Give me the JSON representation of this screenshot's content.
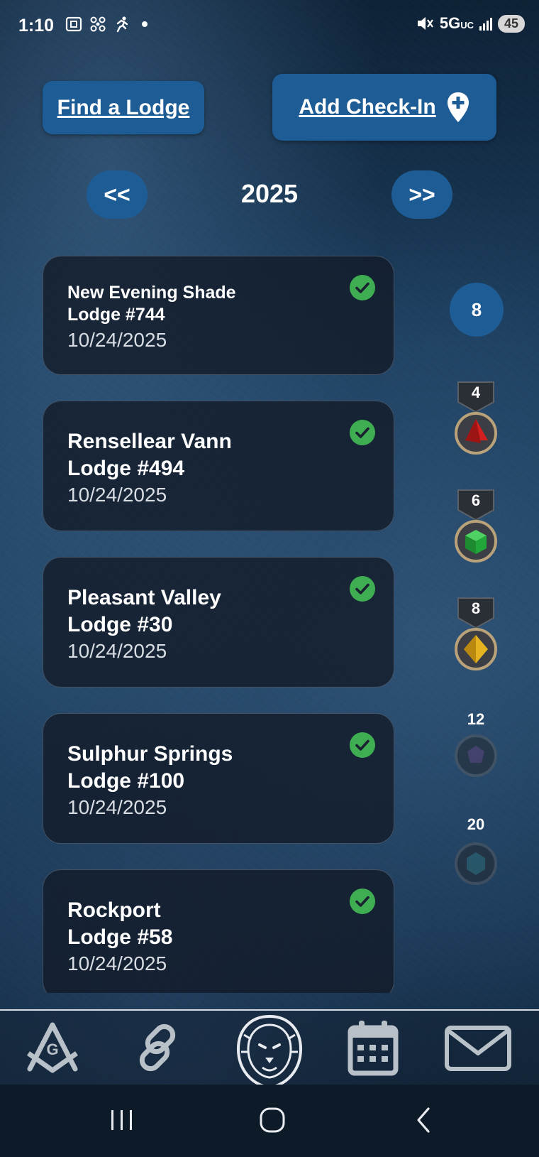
{
  "status_bar": {
    "time": "1:10",
    "network": "5G",
    "network_sub": "UC",
    "battery": "45"
  },
  "header": {
    "find_lodge_label": "Find a Lodge",
    "add_checkin_label": "Add Check-In"
  },
  "year_nav": {
    "prev_label": "<<",
    "year": "2025",
    "next_label": ">>"
  },
  "checkins": [
    {
      "line1": "New Evening Shade",
      "line2": "Lodge #744",
      "date": "10/24/2025",
      "checked": true
    },
    {
      "line1": "Rensellear Vann",
      "line2": "Lodge #494",
      "date": "10/24/2025",
      "checked": true
    },
    {
      "line1": "Pleasant Valley",
      "line2": "Lodge #30",
      "date": "10/24/2025",
      "checked": true
    },
    {
      "line1": "Sulphur Springs",
      "line2": "Lodge #100",
      "date": "10/24/2025",
      "checked": true
    },
    {
      "line1": "Rockport",
      "line2": "Lodge #58",
      "date": "10/24/2025",
      "checked": true
    }
  ],
  "progress": {
    "count": "8",
    "medals": [
      {
        "threshold": "4",
        "gem": "red-tetrahedron-icon",
        "color": "#d21f1f",
        "earned": true
      },
      {
        "threshold": "6",
        "gem": "green-cube-icon",
        "color": "#22a83a",
        "earned": true
      },
      {
        "threshold": "8",
        "gem": "gold-octahedron-icon",
        "color": "#e5b321",
        "earned": true
      },
      {
        "threshold": "12",
        "gem": "purple-dodecahedron-icon",
        "color": "#5a3a6e",
        "earned": false
      },
      {
        "threshold": "20",
        "gem": "teal-icosahedron-icon",
        "color": "#2e6870",
        "earned": false
      }
    ]
  },
  "bottom_nav": {
    "items": [
      "square-compass-icon",
      "link-icon",
      "lion-icon",
      "calendar-icon",
      "mail-icon"
    ]
  },
  "colors": {
    "accent": "#1d5c95",
    "check": "#3fae52",
    "card_bg": "#121926"
  }
}
